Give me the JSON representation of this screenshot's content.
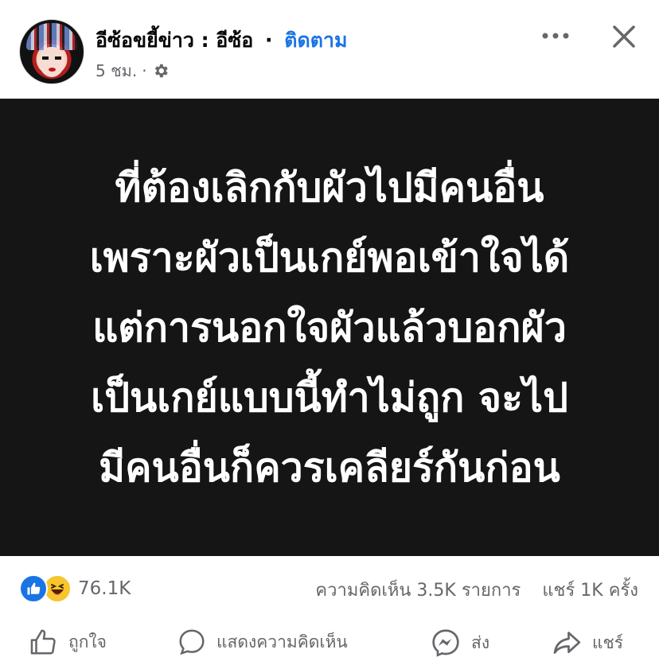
{
  "header": {
    "page_name": "อีซ้อขยี้ข่าว : อีซ้อ",
    "separator": "·",
    "follow_label": "ติดตาม",
    "time": "5 ชม.",
    "meta_dot": "·",
    "privacy_icon": "gear-icon",
    "more_icon": "more-icon",
    "close_icon": "close-icon"
  },
  "post": {
    "background_color": "#151515",
    "text_lines": [
      "ที่ต้องเลิกกับผัวไปมีคนอื่น",
      "เพราะผัวเป็นเกย์พอเข้าใจได้",
      "แต่การนอกใจผัวแล้วบอกผัว",
      "เป็นเกย์แบบนี้ทำไม่ถูก จะไป",
      "มีคนอื่นก็ควรเคลียร์กันก่อน"
    ]
  },
  "stats": {
    "reaction_icons": [
      "like-icon",
      "haha-icon"
    ],
    "reaction_count": "76.1K",
    "comments": "ความคิดเห็น 3.5K รายการ",
    "shares": "แชร์ 1K ครั้ง"
  },
  "actions": {
    "like_label": "ถูกใจ",
    "comment_label": "แสดงความคิดเห็น",
    "send_label": "ส่ง",
    "share_label": "แชร์"
  },
  "colors": {
    "accent": "#1b74e4",
    "muted_text": "#65676b",
    "haha_yellow": "#f7c52e"
  }
}
